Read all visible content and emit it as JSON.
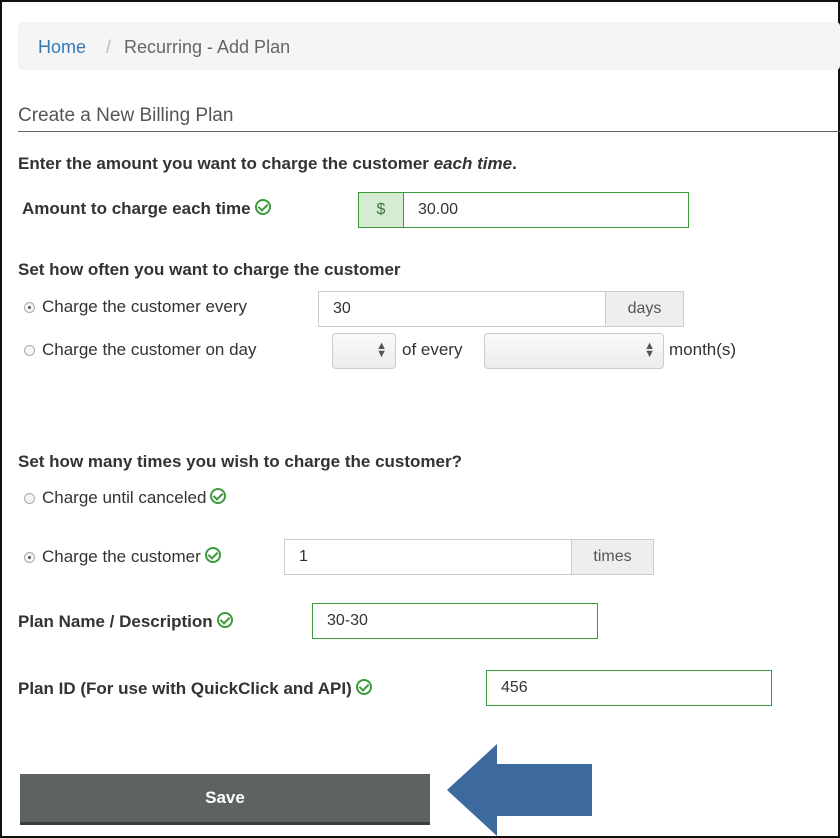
{
  "breadcrumb": {
    "home": "Home",
    "separator": "/",
    "current": "Recurring - Add Plan"
  },
  "form_title": "Create a New Billing Plan",
  "amount": {
    "heading_prefix": "Enter the amount you want to charge the customer ",
    "heading_emphasis": "each time",
    "heading_suffix": ".",
    "label": "Amount to charge each time",
    "currency_symbol": "$",
    "value": "30.00"
  },
  "frequency": {
    "heading": "Set how often you want to charge the customer",
    "option_every_label": "Charge the customer every",
    "option_every_value": "30",
    "option_every_unit": "days",
    "option_every_selected": true,
    "option_day_label": "Charge the customer on day",
    "option_day_of_every": "of every",
    "option_day_unit": "month(s)",
    "option_day_selected": false
  },
  "count": {
    "heading": "Set how many times you wish to charge the customer?",
    "option_until_label": "Charge until canceled",
    "option_until_selected": false,
    "option_times_label": "Charge the customer",
    "option_times_value": "1",
    "option_times_unit": "times",
    "option_times_selected": true
  },
  "plan_name": {
    "label": "Plan Name / Description",
    "value": "30-30"
  },
  "plan_id": {
    "label": "Plan ID (For use with QuickClick and API)",
    "value": "456"
  },
  "save_label": "Save",
  "colors": {
    "valid_green": "#3c9a3c",
    "link_blue": "#337ab7",
    "button_gray": "#5e6263",
    "arrow_blue": "#3d6a9e"
  }
}
